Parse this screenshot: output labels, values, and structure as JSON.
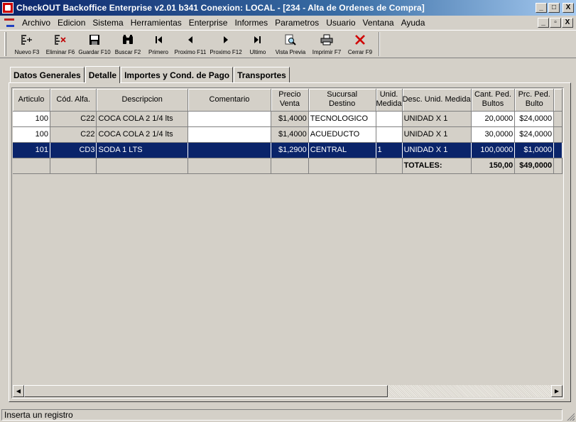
{
  "window": {
    "title": "CheckOUT Backoffice Enterprise v2.01 b341 Conexion: LOCAL - [234 - Alta de Ordenes de Compra]",
    "min_label": "_",
    "max_label": "□",
    "close_label": "X"
  },
  "menu": {
    "items": [
      "Archivo",
      "Edicion",
      "Sistema",
      "Herramientas",
      "Enterprise",
      "Informes",
      "Parametros",
      "Usuario",
      "Ventana",
      "Ayuda"
    ],
    "mdi_min": "_",
    "mdi_restore": "▫",
    "mdi_close": "X"
  },
  "toolbar": {
    "buttons": [
      {
        "label": "Nuevo F3",
        "icon": "new-icon"
      },
      {
        "label": "Eliminar F6",
        "icon": "delete-row-icon"
      },
      {
        "label": "Guardar F10",
        "icon": "save-icon"
      },
      {
        "label": "Buscar F2",
        "icon": "binoculars-icon"
      },
      {
        "label": "Primero",
        "icon": "first-icon"
      },
      {
        "label": "Proximo F11",
        "icon": "prev-icon"
      },
      {
        "label": "Proximo F12",
        "icon": "next-icon"
      },
      {
        "label": "Ultimo",
        "icon": "last-icon"
      },
      {
        "label": "Vista Previa",
        "icon": "preview-icon"
      },
      {
        "label": "Imprimir F7",
        "icon": "print-icon"
      },
      {
        "label": "Cerrar F9",
        "icon": "close-icon"
      }
    ]
  },
  "tabs": [
    "Datos Generales",
    "Detalle",
    "Importes y Cond. de Pago",
    "Transportes"
  ],
  "active_tab": "Detalle",
  "grid": {
    "columns": [
      {
        "l1": "Articulo",
        "l2": ""
      },
      {
        "l1": "Cód. Alfa.",
        "l2": ""
      },
      {
        "l1": "Descripcion",
        "l2": ""
      },
      {
        "l1": "Comentario",
        "l2": ""
      },
      {
        "l1": "Precio",
        "l2": "Venta"
      },
      {
        "l1": "Sucursal",
        "l2": "Destino"
      },
      {
        "l1": "Unid.",
        "l2": "Medida"
      },
      {
        "l1": "Desc. Unid. Medida",
        "l2": ""
      },
      {
        "l1": "Cant. Ped.",
        "l2": "Bultos"
      },
      {
        "l1": "Prc. Ped.",
        "l2": "Bulto"
      }
    ],
    "rows": [
      {
        "articulo": "100",
        "cod": "C22",
        "descripcion": "COCA COLA 2 1/4 lts",
        "comentario": "",
        "precio": "$1,4000",
        "sucursal": "TECNOLOGICO",
        "unid": "",
        "desc_unid": "UNIDAD X 1",
        "cant": "20,0000",
        "prc": "$24,0000",
        "selected": false
      },
      {
        "articulo": "100",
        "cod": "C22",
        "descripcion": "COCA COLA 2 1/4 lts",
        "comentario": "",
        "precio": "$1,4000",
        "sucursal": "ACUEDUCTO",
        "unid": "",
        "desc_unid": "UNIDAD X 1",
        "cant": "30,0000",
        "prc": "$24,0000",
        "selected": false
      },
      {
        "articulo": "101",
        "cod": "CD3",
        "descripcion": "SODA 1 LTS",
        "comentario": "",
        "precio": "$1,2900",
        "sucursal": "CENTRAL",
        "unid": "1",
        "desc_unid": "UNIDAD X 1",
        "cant": "100,0000",
        "prc": "$1,0000",
        "selected": true
      }
    ],
    "totals": {
      "label": "TOTALES:",
      "cant": "150,00",
      "prc": "$49,0000"
    }
  },
  "status": {
    "text": "Inserta un registro"
  },
  "colors": {
    "selection": "#0a246a",
    "face": "#d4d0c8",
    "title_start": "#0a246a",
    "title_end": "#a6caf0"
  }
}
